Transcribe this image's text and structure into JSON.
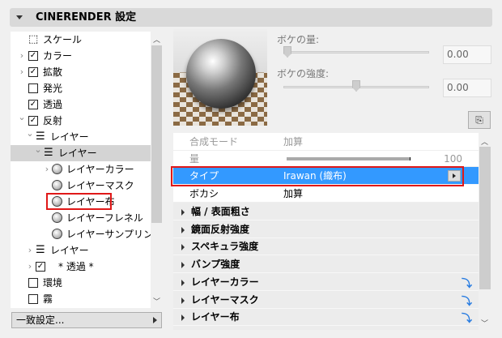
{
  "header": {
    "title": "CINERENDER 設定"
  },
  "tree": [
    {
      "label": "スケール",
      "icon": "scale-icon",
      "level": 0,
      "chevron": "none",
      "check": "none"
    },
    {
      "label": "カラー",
      "level": 0,
      "chevron": "right",
      "check": "checked"
    },
    {
      "label": "拡散",
      "level": 0,
      "chevron": "right",
      "check": "checked"
    },
    {
      "label": "発光",
      "level": 0,
      "chevron": "none",
      "check": "unchecked"
    },
    {
      "label": "透過",
      "level": 0,
      "chevron": "none",
      "check": "checked"
    },
    {
      "label": "反射",
      "level": 0,
      "chevron": "down",
      "check": "checked"
    },
    {
      "label": "レイヤー",
      "level": 1,
      "chevron": "down",
      "icon": "layers-icon"
    },
    {
      "label": "レイヤー",
      "level": 2,
      "chevron": "down",
      "icon": "layers-icon",
      "selected": true
    },
    {
      "label": "レイヤーカラー",
      "level": 3,
      "chevron": "right",
      "icon": "sphere-icon"
    },
    {
      "label": "レイヤーマスク",
      "level": 3,
      "chevron": "none",
      "icon": "sphere-icon"
    },
    {
      "label": "レイヤー布",
      "level": 3,
      "chevron": "none",
      "icon": "sphere-icon"
    },
    {
      "label": "レイヤーフレネル",
      "level": 3,
      "chevron": "none",
      "icon": "sphere-icon"
    },
    {
      "label": "レイヤーサンプリング",
      "level": 3,
      "chevron": "none",
      "icon": "sphere-icon"
    },
    {
      "label": "レイヤー",
      "level": 1,
      "chevron": "right",
      "icon": "layers-icon"
    },
    {
      "label": "* 透過 *",
      "level": 1,
      "chevron": "right",
      "check": "checked"
    },
    {
      "label": "環境",
      "level": 0,
      "chevron": "none",
      "check": "unchecked"
    },
    {
      "label": "霧",
      "level": 0,
      "chevron": "none",
      "check": "unchecked"
    }
  ],
  "match_button": "一致設定...",
  "bokeh": {
    "amount_label": "ボケの量:",
    "amount_value": "0.00",
    "amount_slider": 0,
    "strength_label": "ボケの強度:",
    "strength_value": "0.00",
    "strength_slider": 0.5
  },
  "props": {
    "blend_mode": {
      "label": "合成モード",
      "value": "加算"
    },
    "amount": {
      "label": "量",
      "value": "100",
      "fill": 1.0
    },
    "type": {
      "label": "タイプ",
      "value": "Irawan (織布)"
    },
    "blur": {
      "label": "ボカシ",
      "value": "加算"
    },
    "groups": [
      "幅 / 表面粗さ",
      "鏡面反射強度",
      "スペキュラ強度",
      "バンプ強度",
      "レイヤーカラー",
      "レイヤーマスク",
      "レイヤー布"
    ]
  },
  "colors": {
    "selection": "#3399ff",
    "highlight": "#e01818"
  }
}
